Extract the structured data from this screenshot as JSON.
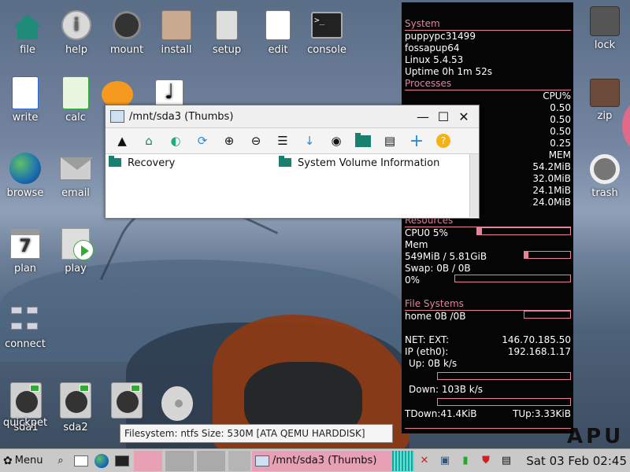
{
  "desktop_icons": [
    {
      "key": "file",
      "label": "file"
    },
    {
      "key": "help",
      "label": "help",
      "glyph": "i"
    },
    {
      "key": "mount",
      "label": "mount"
    },
    {
      "key": "install",
      "label": "install"
    },
    {
      "key": "setup",
      "label": "setup"
    },
    {
      "key": "edit",
      "label": "edit"
    },
    {
      "key": "console",
      "label": "console",
      "glyph": ">_"
    },
    {
      "key": "write",
      "label": "write"
    },
    {
      "key": "calc",
      "label": "calc"
    },
    {
      "key": "browse",
      "label": "browse"
    },
    {
      "key": "email",
      "label": "email"
    },
    {
      "key": "plan",
      "label": "plan",
      "glyph": "7"
    },
    {
      "key": "play",
      "label": "play"
    },
    {
      "key": "connect",
      "label": "connect"
    },
    {
      "key": "quickpet",
      "label": "quickpet"
    },
    {
      "key": "sda1",
      "label": "sda1"
    },
    {
      "key": "sda2",
      "label": "sda2"
    },
    {
      "key": "lock",
      "label": "lock"
    },
    {
      "key": "zip",
      "label": "zip"
    },
    {
      "key": "trash",
      "label": "trash"
    }
  ],
  "conky": {
    "system_header": "System",
    "hostname": "puppypc31499",
    "distro": "fossapup64",
    "kernel": "Linux 5.4.53",
    "uptime": "Uptime 0h 1m 52s",
    "processes_header": "Processes",
    "cpu_col": "CPU%",
    "cpu_values": [
      "0.50",
      "0.50",
      "0.50",
      "0.25"
    ],
    "mem_col": "MEM",
    "mem_values": [
      "54.2MiB",
      "32.0MiB",
      "24.1MiB",
      "24.0MiB"
    ],
    "resources_header": "Resources",
    "cpu0": "CPU0 5%",
    "cpu0_frac": 0.05,
    "mem_label": "Mem",
    "mem_usage": "549MiB / 5.81GiB",
    "mem_frac": 0.09,
    "swap": "Swap: 0B  / 0B",
    "swap_pct": "0%",
    "fs_header": "File Systems",
    "home": "home 0B  /0B",
    "net_ext_label": "NET: EXT:",
    "net_ext": "146.70.185.50",
    "ip_label": "IP (eth0):",
    "ip": "192.168.1.17",
    "up": "Up: 0B   k/s",
    "down": "Down: 103B  k/s",
    "tdown": "TDown:41.4KiB",
    "tup": "TUp:3.33KiB"
  },
  "window": {
    "title": "/mnt/sda3 (Thumbs)",
    "items": [
      {
        "name": "Recovery"
      },
      {
        "name": "System Volume Information"
      }
    ]
  },
  "tooltip": "Filesystem: ntfs Size: 530M  [ATA QEMU HARDDISK]",
  "taskbar": {
    "menu": "Menu",
    "task": "/mnt/sda3 (Thumbs)",
    "clock": "Sat 03 Feb 02:45"
  },
  "colors": {
    "accent": "#e8829b",
    "folder": "#17806f"
  }
}
